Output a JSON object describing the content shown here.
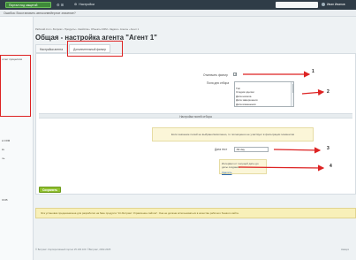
{
  "topbar": {
    "portal_button": "Портал под защитой",
    "icons_label": "⚙ ⊞",
    "settings_label": "Настройки",
    "user_name": "Иван Иванов"
  },
  "warnbar": {
    "text": "Ошибка: Восстановить автоконвейерное значение?"
  },
  "sidebar": {
    "items": [
      "Мой 1С-Битрикс",
      "...",
      "Главное",
      "Меню",
      "Ресурсы",
      "CRM",
      "Задачи",
      "Почта"
    ],
    "items_visible": [
      "отчет процессов",
      "в CRM",
      "вч",
      "ль",
      "ОСВ"
    ]
  },
  "breadcrumb": "Рабочий стол › Битрикс › Продукты › Свойства › Объекты CRM › Задачи › Агенты › Агент 1",
  "page": {
    "title": "Общая - настройка агента \"Агент 1\""
  },
  "tabs": [
    {
      "label": "Настройки агента"
    },
    {
      "label": "Дополнительный фильтр"
    }
  ],
  "form": {
    "filter_label": "Отключить фильтр",
    "list_label": "Поля для отбора",
    "list_options": [
      "",
      "Тип",
      "Стадия сделки",
      "Дата начала",
      "Дата завершения",
      "Дата изменения"
    ],
    "section_header": "Настройки полей отбора",
    "notice_text": "Если значение полей не выбрано/заполнено, то полноценно не участвует в фильтрации элементов",
    "date_label": "Дата тест",
    "date_value": "-69 day",
    "notice2_text": "Интервал от текущей даты до даты создания",
    "notice2_link": "Удалить",
    "save_label": "Сохранить"
  },
  "annotations": [
    "1",
    "2",
    "3",
    "4"
  ],
  "bottom_notice": "Эта установка предназначена для разработки на базе продукта \"1С-Битрикс: Управление сайтом\". Она не должна использоваться в качестве рабочего боевого сайта.",
  "footer": {
    "left": "© Битрикс. Корпоративный портал 25.100.100. ©Битрикс, 2002-2025",
    "right": "Наверх"
  },
  "colors": {
    "highlight": "#dd2222",
    "topbar": "#2f3c47",
    "save": "#8fbf2e"
  }
}
